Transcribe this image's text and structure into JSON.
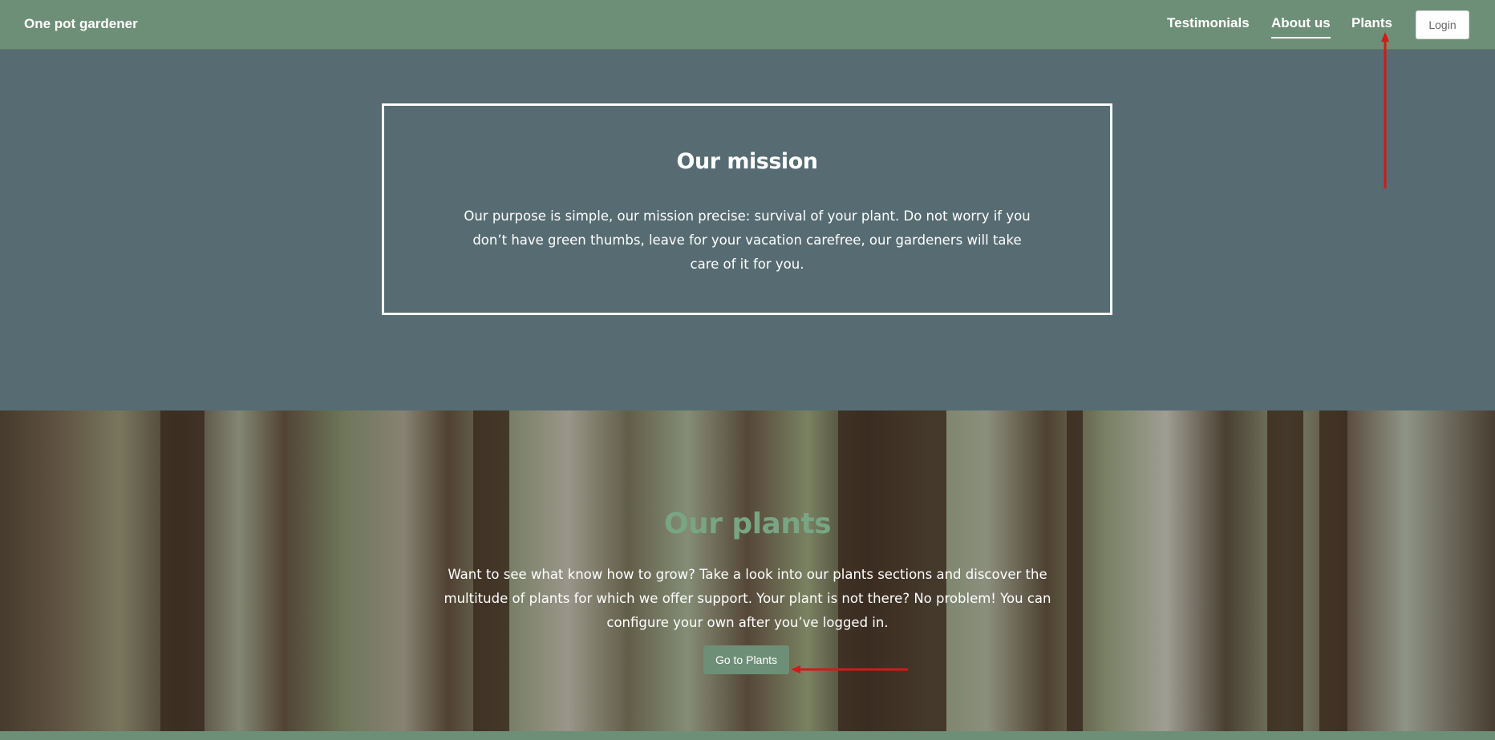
{
  "navbar": {
    "brand": "One pot gardener",
    "links": [
      {
        "label": "Testimonials"
      },
      {
        "label": "About us",
        "active": true
      },
      {
        "label": "Plants"
      }
    ],
    "login_label": "Login"
  },
  "mission": {
    "title": "Our mission",
    "text": "Our purpose is simple, our mission precise: survival of your plant. Do not worry if you don’t have green thumbs, leave for your vacation carefree, our gardeners will take care of it for you."
  },
  "plants": {
    "title": "Our plants",
    "text": "Want to see what know how to grow? Take a look into our plants sections and discover the multitude of plants for which we offer support. Your plant is not there? No problem! You can configure your own after you’ve logged in.",
    "button_label": "Go to Plants"
  },
  "colors": {
    "navbar": "#6e8f77",
    "mission_bg": "#566c72",
    "plants_title": "#78a584",
    "annotation_arrow": "#d11a1a"
  }
}
